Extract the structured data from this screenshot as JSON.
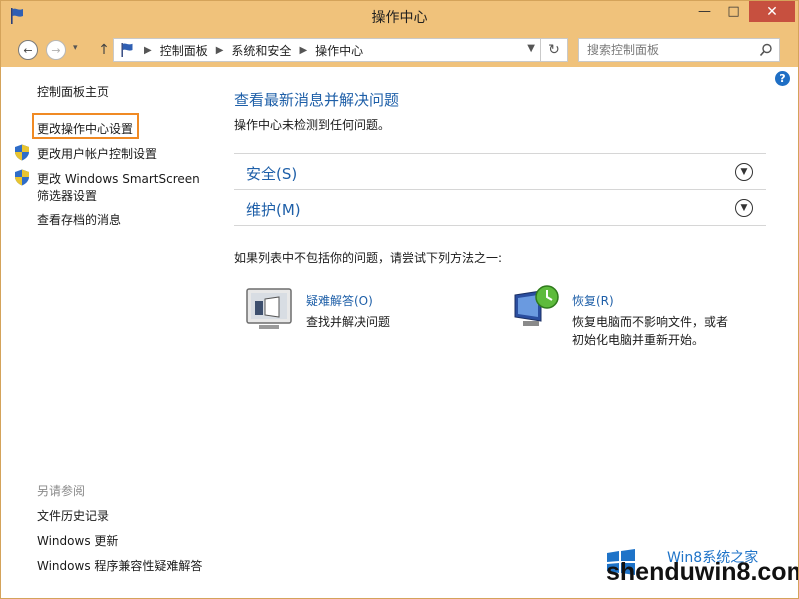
{
  "window": {
    "title": "操作中心"
  },
  "address": {
    "crumbs": [
      "控制面板",
      "系统和安全",
      "操作中心"
    ],
    "search_placeholder": "搜索控制面板"
  },
  "sidebar": {
    "items": [
      {
        "label": "控制面板主页"
      },
      {
        "label": "更改操作中心设置"
      },
      {
        "label": "更改用户帐户控制设置"
      },
      {
        "label": "更改 Windows SmartScreen",
        "label2": "筛选器设置"
      },
      {
        "label": "查看存档的消息"
      }
    ],
    "see_also": {
      "heading": "另请参阅",
      "links": [
        "文件历史记录",
        "Windows 更新",
        "Windows 程序兼容性疑难解答"
      ]
    }
  },
  "main": {
    "title": "查看最新消息并解决问题",
    "subtitle": "操作中心未检测到任何问题。",
    "sections": [
      {
        "label": "安全(S)"
      },
      {
        "label": "维护(M)"
      }
    ],
    "hint": "如果列表中不包括你的问题，请尝试下列方法之一:",
    "tasks": [
      {
        "title": "疑难解答(O)",
        "desc": "查找并解决问题"
      },
      {
        "title": "恢复(R)",
        "desc1": "恢复电脑而不影响文件，或者",
        "desc2": "初始化电脑并重新开始。"
      }
    ]
  },
  "watermark": {
    "text": "shenduwin8.com",
    "sub": "Win8系统之家"
  },
  "colors": {
    "titlebar": "#f0c27b",
    "link": "#1e5fa8",
    "highlight": "#f08a24",
    "close": "#c7503f"
  }
}
